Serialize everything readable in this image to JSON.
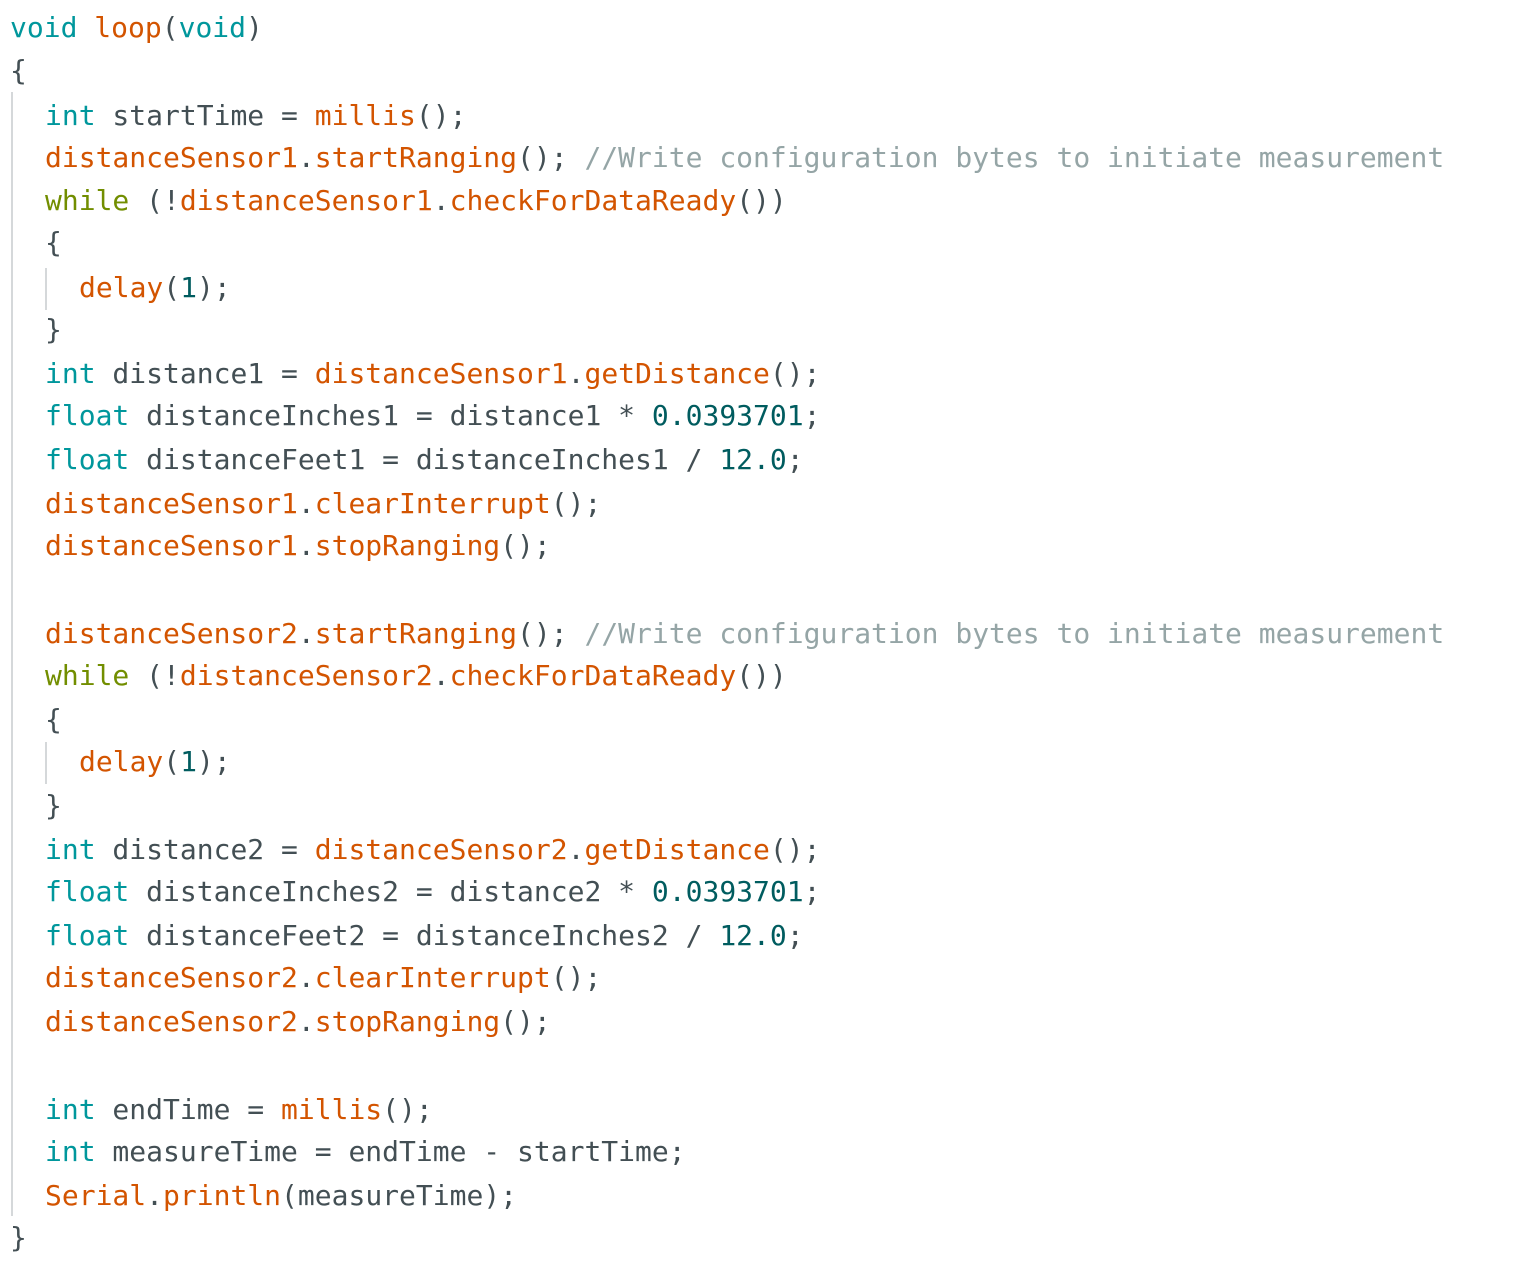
{
  "colors": {
    "background": "#ffffff",
    "type": "#00979c",
    "function": "#d35400",
    "keyword": "#728e00",
    "comment": "#95a5a6",
    "number": "#005c5f",
    "plain": "#434f54",
    "guide": "#d5d8da"
  },
  "code": {
    "lines": [
      {
        "indent": 0,
        "tokens": [
          {
            "t": "void",
            "k": "type"
          },
          {
            "t": " ",
            "k": "plain"
          },
          {
            "t": "loop",
            "k": "function"
          },
          {
            "t": "(",
            "k": "plain"
          },
          {
            "t": "void",
            "k": "type"
          },
          {
            "t": ")",
            "k": "plain"
          }
        ]
      },
      {
        "indent": 0,
        "tokens": [
          {
            "t": "{",
            "k": "plain"
          }
        ]
      },
      {
        "indent": 1,
        "tokens": [
          {
            "t": "int",
            "k": "type"
          },
          {
            "t": " startTime = ",
            "k": "plain"
          },
          {
            "t": "millis",
            "k": "function"
          },
          {
            "t": "();",
            "k": "plain"
          }
        ]
      },
      {
        "indent": 1,
        "tokens": [
          {
            "t": "distanceSensor1",
            "k": "function"
          },
          {
            "t": ".",
            "k": "plain"
          },
          {
            "t": "startRanging",
            "k": "function"
          },
          {
            "t": "(); ",
            "k": "plain"
          },
          {
            "t": "//Write configuration bytes to initiate measurement",
            "k": "comment"
          }
        ]
      },
      {
        "indent": 1,
        "tokens": [
          {
            "t": "while",
            "k": "keyword"
          },
          {
            "t": " (!",
            "k": "plain"
          },
          {
            "t": "distanceSensor1",
            "k": "function"
          },
          {
            "t": ".",
            "k": "plain"
          },
          {
            "t": "checkForDataReady",
            "k": "function"
          },
          {
            "t": "())",
            "k": "plain"
          }
        ]
      },
      {
        "indent": 1,
        "tokens": [
          {
            "t": "{",
            "k": "plain"
          }
        ]
      },
      {
        "indent": 2,
        "tokens": [
          {
            "t": "delay",
            "k": "function"
          },
          {
            "t": "(",
            "k": "plain"
          },
          {
            "t": "1",
            "k": "number"
          },
          {
            "t": ");",
            "k": "plain"
          }
        ]
      },
      {
        "indent": 1,
        "tokens": [
          {
            "t": "}",
            "k": "plain"
          }
        ]
      },
      {
        "indent": 1,
        "tokens": [
          {
            "t": "int",
            "k": "type"
          },
          {
            "t": " distance1 = ",
            "k": "plain"
          },
          {
            "t": "distanceSensor1",
            "k": "function"
          },
          {
            "t": ".",
            "k": "plain"
          },
          {
            "t": "getDistance",
            "k": "function"
          },
          {
            "t": "();",
            "k": "plain"
          }
        ]
      },
      {
        "indent": 1,
        "tokens": [
          {
            "t": "float",
            "k": "type"
          },
          {
            "t": " distanceInches1 = distance1 * ",
            "k": "plain"
          },
          {
            "t": "0.0393701",
            "k": "number"
          },
          {
            "t": ";",
            "k": "plain"
          }
        ]
      },
      {
        "indent": 1,
        "tokens": [
          {
            "t": "float",
            "k": "type"
          },
          {
            "t": " distanceFeet1 = distanceInches1 / ",
            "k": "plain"
          },
          {
            "t": "12.0",
            "k": "number"
          },
          {
            "t": ";",
            "k": "plain"
          }
        ]
      },
      {
        "indent": 1,
        "tokens": [
          {
            "t": "distanceSensor1",
            "k": "function"
          },
          {
            "t": ".",
            "k": "plain"
          },
          {
            "t": "clearInterrupt",
            "k": "function"
          },
          {
            "t": "();",
            "k": "plain"
          }
        ]
      },
      {
        "indent": 1,
        "tokens": [
          {
            "t": "distanceSensor1",
            "k": "function"
          },
          {
            "t": ".",
            "k": "plain"
          },
          {
            "t": "stopRanging",
            "k": "function"
          },
          {
            "t": "();",
            "k": "plain"
          }
        ]
      },
      {
        "indent": 1,
        "tokens": []
      },
      {
        "indent": 1,
        "tokens": [
          {
            "t": "distanceSensor2",
            "k": "function"
          },
          {
            "t": ".",
            "k": "plain"
          },
          {
            "t": "startRanging",
            "k": "function"
          },
          {
            "t": "(); ",
            "k": "plain"
          },
          {
            "t": "//Write configuration bytes to initiate measurement",
            "k": "comment"
          }
        ]
      },
      {
        "indent": 1,
        "tokens": [
          {
            "t": "while",
            "k": "keyword"
          },
          {
            "t": " (!",
            "k": "plain"
          },
          {
            "t": "distanceSensor2",
            "k": "function"
          },
          {
            "t": ".",
            "k": "plain"
          },
          {
            "t": "checkForDataReady",
            "k": "function"
          },
          {
            "t": "())",
            "k": "plain"
          }
        ]
      },
      {
        "indent": 1,
        "tokens": [
          {
            "t": "{",
            "k": "plain"
          }
        ]
      },
      {
        "indent": 2,
        "tokens": [
          {
            "t": "delay",
            "k": "function"
          },
          {
            "t": "(",
            "k": "plain"
          },
          {
            "t": "1",
            "k": "number"
          },
          {
            "t": ");",
            "k": "plain"
          }
        ]
      },
      {
        "indent": 1,
        "tokens": [
          {
            "t": "}",
            "k": "plain"
          }
        ]
      },
      {
        "indent": 1,
        "tokens": [
          {
            "t": "int",
            "k": "type"
          },
          {
            "t": " distance2 = ",
            "k": "plain"
          },
          {
            "t": "distanceSensor2",
            "k": "function"
          },
          {
            "t": ".",
            "k": "plain"
          },
          {
            "t": "getDistance",
            "k": "function"
          },
          {
            "t": "();",
            "k": "plain"
          }
        ]
      },
      {
        "indent": 1,
        "tokens": [
          {
            "t": "float",
            "k": "type"
          },
          {
            "t": " distanceInches2 = distance2 * ",
            "k": "plain"
          },
          {
            "t": "0.0393701",
            "k": "number"
          },
          {
            "t": ";",
            "k": "plain"
          }
        ]
      },
      {
        "indent": 1,
        "tokens": [
          {
            "t": "float",
            "k": "type"
          },
          {
            "t": " distanceFeet2 = distanceInches2 / ",
            "k": "plain"
          },
          {
            "t": "12.0",
            "k": "number"
          },
          {
            "t": ";",
            "k": "plain"
          }
        ]
      },
      {
        "indent": 1,
        "tokens": [
          {
            "t": "distanceSensor2",
            "k": "function"
          },
          {
            "t": ".",
            "k": "plain"
          },
          {
            "t": "clearInterrupt",
            "k": "function"
          },
          {
            "t": "();",
            "k": "plain"
          }
        ]
      },
      {
        "indent": 1,
        "tokens": [
          {
            "t": "distanceSensor2",
            "k": "function"
          },
          {
            "t": ".",
            "k": "plain"
          },
          {
            "t": "stopRanging",
            "k": "function"
          },
          {
            "t": "();",
            "k": "plain"
          }
        ]
      },
      {
        "indent": 1,
        "tokens": []
      },
      {
        "indent": 1,
        "tokens": [
          {
            "t": "int",
            "k": "type"
          },
          {
            "t": " endTime = ",
            "k": "plain"
          },
          {
            "t": "millis",
            "k": "function"
          },
          {
            "t": "();",
            "k": "plain"
          }
        ]
      },
      {
        "indent": 1,
        "tokens": [
          {
            "t": "int",
            "k": "type"
          },
          {
            "t": " measureTime = endTime - startTime;",
            "k": "plain"
          }
        ]
      },
      {
        "indent": 1,
        "tokens": [
          {
            "t": "Serial",
            "k": "function"
          },
          {
            "t": ".",
            "k": "plain"
          },
          {
            "t": "println",
            "k": "function"
          },
          {
            "t": "(measureTime);",
            "k": "plain"
          }
        ]
      },
      {
        "indent": 0,
        "tokens": [
          {
            "t": "}",
            "k": "plain"
          }
        ]
      }
    ]
  }
}
